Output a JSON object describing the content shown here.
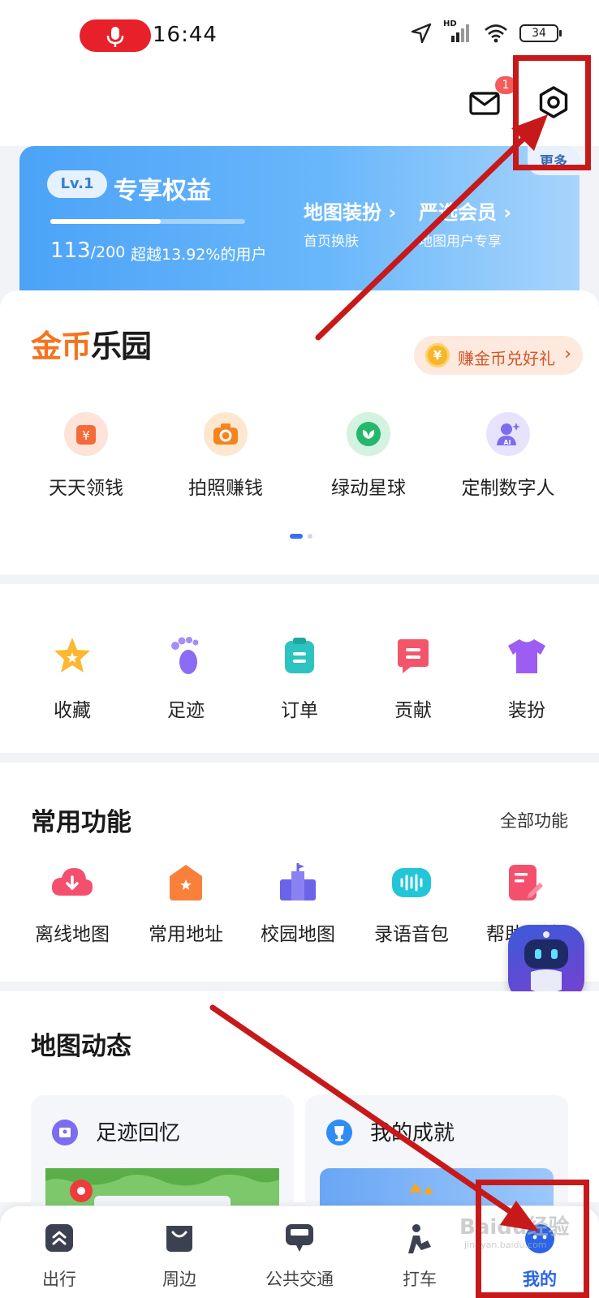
{
  "status_bar": {
    "time": "16:44",
    "battery": "34",
    "network": "HD"
  },
  "header": {
    "mail_badge": "1"
  },
  "vip": {
    "level": "Lv.1",
    "title": "专享权益",
    "score": "113",
    "score_total": "/200",
    "beat_text": "超越13.92%的用户",
    "progress": 0.565,
    "links": [
      {
        "title": "地图装扮",
        "sub": "首页换肤"
      },
      {
        "title": "严选会员",
        "sub": "地图用户专享"
      }
    ],
    "more": "更多"
  },
  "coins": {
    "logo_a": "金币",
    "logo_b": "乐园",
    "exchange": "赚金币兑好礼",
    "coin_symbol": "¥",
    "items": [
      {
        "label": "天天领钱",
        "icon": "yen-bag-icon",
        "color": "#f46b3a"
      },
      {
        "label": "拍照赚钱",
        "icon": "camera-icon",
        "color": "#f5841f"
      },
      {
        "label": "绿动星球",
        "icon": "green-planet-icon",
        "color": "#25b86c"
      },
      {
        "label": "定制数字人",
        "icon": "ai-avatar-icon",
        "color": "#7b6cf0"
      }
    ]
  },
  "quick": {
    "items": [
      {
        "label": "收藏",
        "icon": "star-icon"
      },
      {
        "label": "足迹",
        "icon": "footprint-icon"
      },
      {
        "label": "订单",
        "icon": "order-icon"
      },
      {
        "label": "贡献",
        "icon": "contribution-icon"
      },
      {
        "label": "装扮",
        "icon": "tshirt-icon"
      }
    ]
  },
  "common": {
    "title": "常用功能",
    "all": "全部功能",
    "items": [
      {
        "label": "离线地图",
        "icon": "offline-map-icon"
      },
      {
        "label": "常用地址",
        "icon": "home-address-icon"
      },
      {
        "label": "校园地图",
        "icon": "campus-map-icon"
      },
      {
        "label": "录语音包",
        "icon": "voice-pack-icon"
      },
      {
        "label": "帮助反馈",
        "icon": "feedback-icon"
      }
    ]
  },
  "dynamics": {
    "title": "地图动态",
    "cards": [
      {
        "title": "足迹回忆",
        "icon": "memory-icon"
      },
      {
        "title": "我的成就",
        "icon": "trophy-icon"
      }
    ]
  },
  "tabbar": {
    "tabs": [
      {
        "label": "出行",
        "icon": "travel-icon"
      },
      {
        "label": "周边",
        "icon": "nearby-icon"
      },
      {
        "label": "公共交通",
        "icon": "bus-icon"
      },
      {
        "label": "打车",
        "icon": "taxi-icon"
      },
      {
        "label": "我的",
        "icon": "mine-icon"
      }
    ]
  },
  "watermark": {
    "text": "Baidu经验",
    "sub": "jingyan.baidu.com"
  },
  "colors": {
    "accent": "#2a64e8",
    "annotation": "#c8191a",
    "coin_orange": "#f5731f"
  }
}
